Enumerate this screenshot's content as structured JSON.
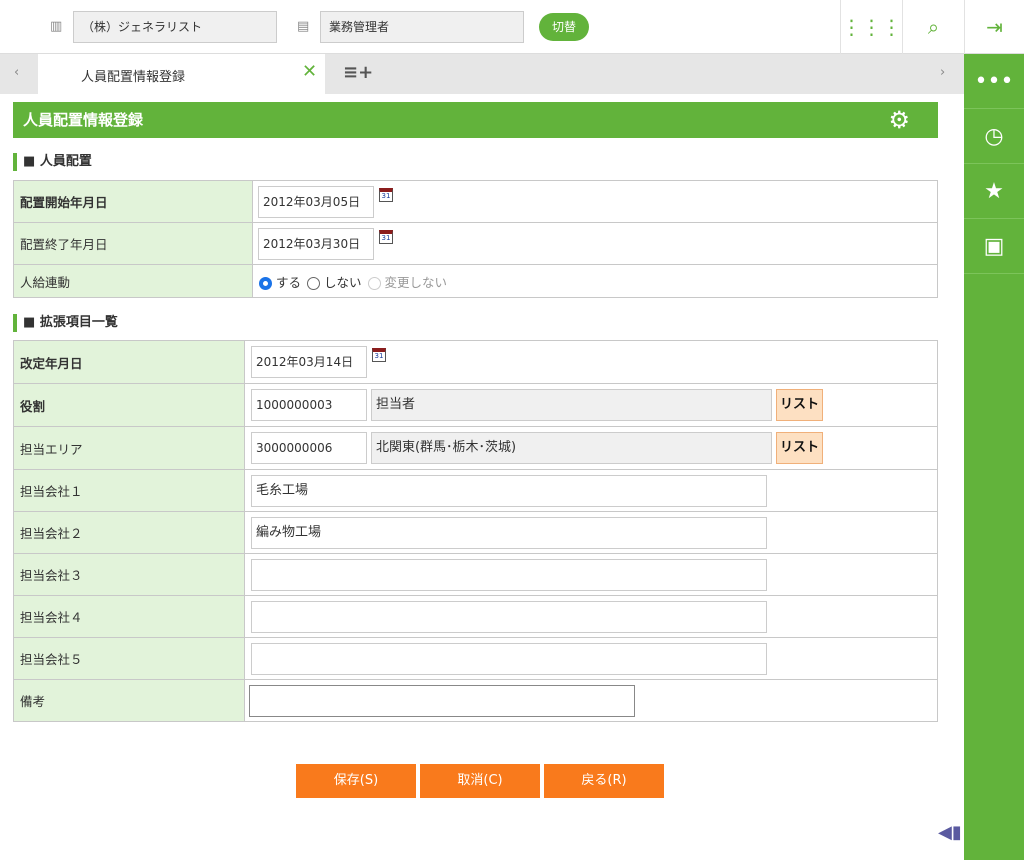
{
  "header": {
    "company": "（株）ジェネラリスト",
    "role": "業務管理者",
    "switch_label": "切替"
  },
  "tabs": [
    {
      "label": "人員配置情報登録"
    }
  ],
  "page_title": "人員配置情報登録",
  "section1": {
    "title": "人員配置",
    "rows": [
      {
        "label": "配置開始年月日",
        "value": "2012年03月05日"
      },
      {
        "label": "配置終了年月日",
        "value": "2012年03月30日"
      },
      {
        "label": "人給連動",
        "options": [
          "する",
          "しない",
          "変更しない"
        ],
        "selected": "する"
      }
    ]
  },
  "section2": {
    "title": "拡張項目一覧",
    "rows": [
      {
        "label": "改定年月日",
        "value": "2012年03月14日"
      },
      {
        "label": "役割",
        "code": "1000000003",
        "name": "担当者",
        "button": "リスト"
      },
      {
        "label": "担当エリア",
        "code": "3000000006",
        "name": "北関東(群馬･栃木･茨城)",
        "button": "リスト"
      },
      {
        "label": "担当会社１",
        "value": "毛糸工場"
      },
      {
        "label": "担当会社２",
        "value": "編み物工場"
      },
      {
        "label": "担当会社３",
        "value": ""
      },
      {
        "label": "担当会社４",
        "value": ""
      },
      {
        "label": "担当会社５",
        "value": ""
      },
      {
        "label": "備考",
        "value": ""
      }
    ]
  },
  "buttons": {
    "save": "保存(S)",
    "cancel": "取消(C)",
    "back": "戻る(R)"
  },
  "calendar_icon_text": "31",
  "colors": {
    "accent": "#62b33b",
    "action": "#f97a1c"
  }
}
